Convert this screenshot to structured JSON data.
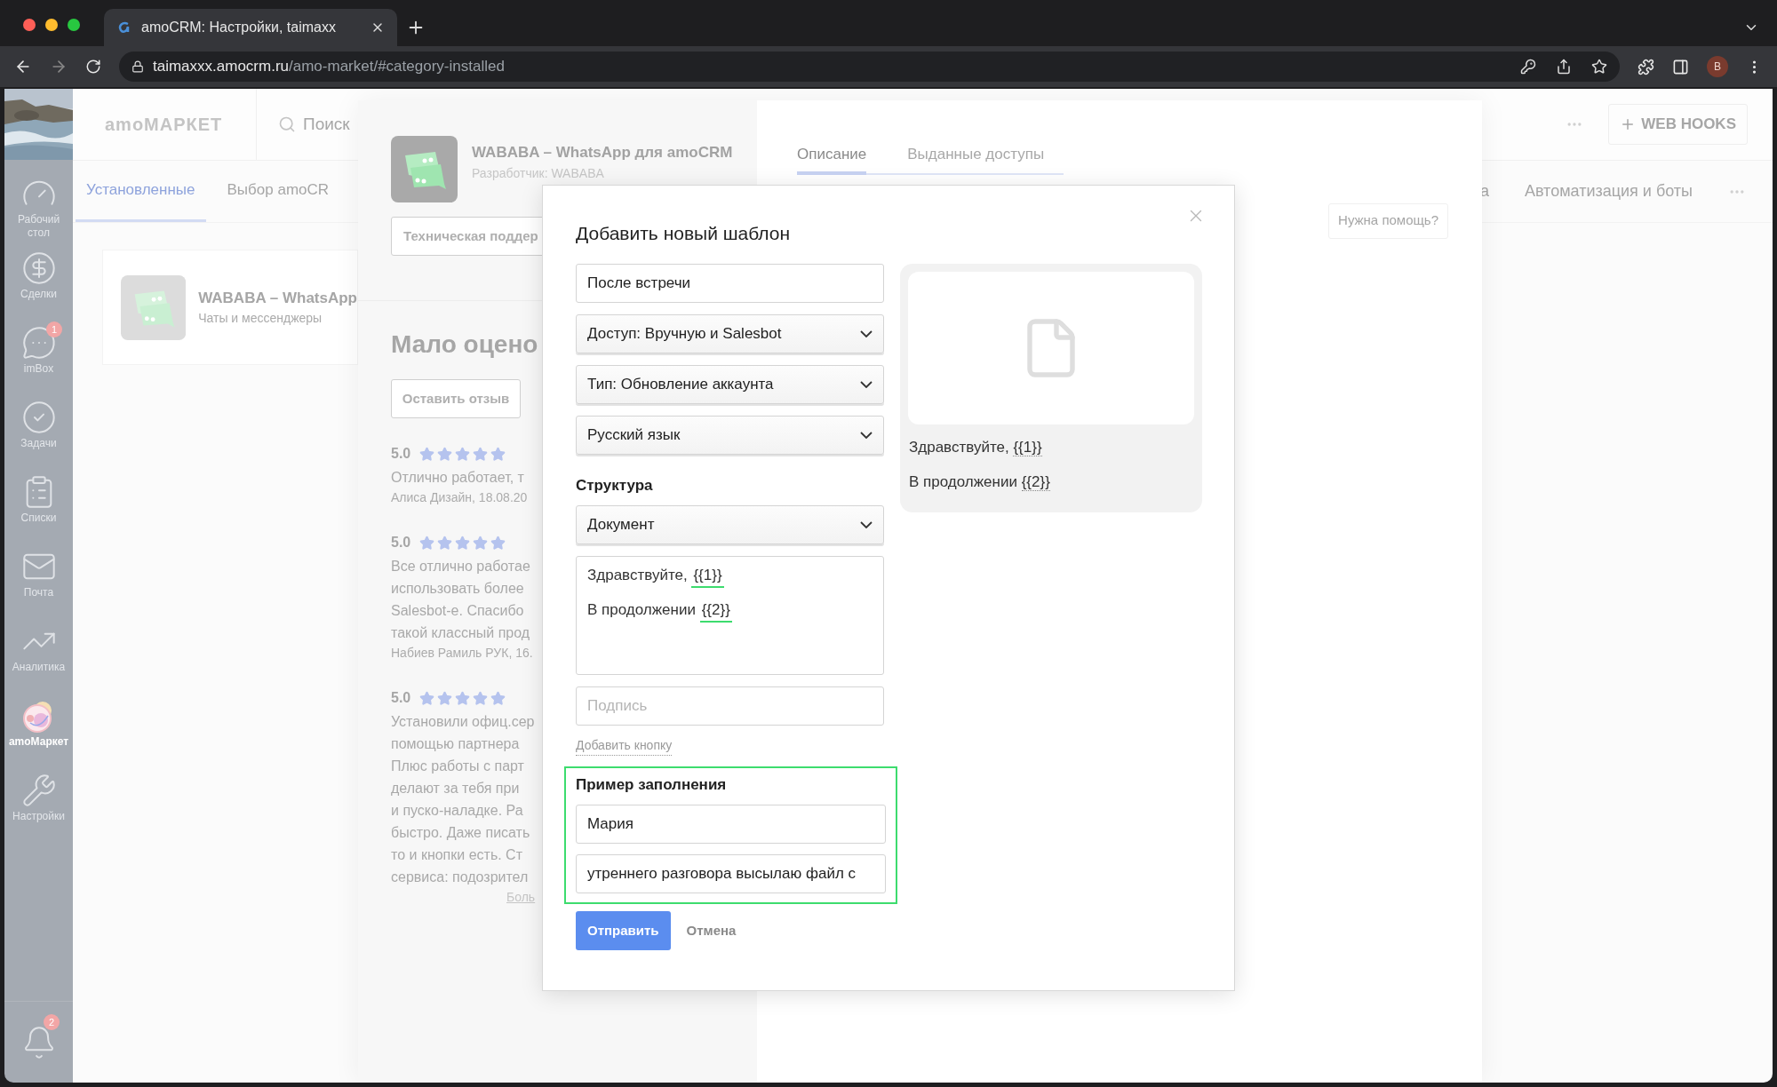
{
  "browser": {
    "tab_title": "amoCRM: Настройки, taimaxx",
    "url_host": "taimaxxx.amocrm.ru",
    "url_path": "/amo-market/#category-installed",
    "profile": "B"
  },
  "sidebar": {
    "items": [
      {
        "label": "Рабочий стол",
        "selected": false
      },
      {
        "label": "Сделки",
        "selected": false
      },
      {
        "label": "imBox",
        "selected": false,
        "badge": "1"
      },
      {
        "label": "Задачи",
        "selected": false
      },
      {
        "label": "Списки",
        "selected": false
      },
      {
        "label": "Почта",
        "selected": false
      },
      {
        "label": "Аналитика",
        "selected": false
      },
      {
        "label": "amoМаркет",
        "selected": true
      },
      {
        "label": "Настройки",
        "selected": false
      }
    ],
    "notifications_badge": "2"
  },
  "header": {
    "logo": "amoМАРКЕТ",
    "search_placeholder": "Поиск",
    "web_hooks_button": "WEB HOOKS"
  },
  "category_tabs": {
    "left": [
      {
        "label": "Установленные",
        "selected": true
      },
      {
        "label": "Выбор amoCR",
        "selected": false
      }
    ],
    "right": [
      {
        "label": "а",
        "selected": false
      },
      {
        "label": "Автоматизация и боты",
        "selected": false
      }
    ]
  },
  "installed_app": {
    "name": "WABABA – WhatsApp",
    "category": "Чаты и мессенджеры"
  },
  "app_panel": {
    "name": "WABABA – WhatsApp для amoCRM",
    "developer": "Разработчик: WABABA",
    "support_button": "Техническая поддер",
    "rating_heading": "Мало оцено",
    "review_button": "Оставить отзыв",
    "reviews": [
      {
        "score": "5.0",
        "stars": 5,
        "lines": [
          "Отлично работает, т"
        ],
        "author": "Алиса Дизайн, 18.08.20"
      },
      {
        "score": "5.0",
        "stars": 5,
        "lines": [
          "Все отлично работае",
          "использовать более",
          "Salesbot-е. Спасибо",
          "такой классный прод"
        ],
        "author": "Набиев Рамиль РУК, 16."
      },
      {
        "score": "5.0",
        "stars": 5,
        "lines": [
          "Установили офиц.сер",
          "помощью партнера",
          "Плюс работы с парт",
          "делают за тебя при",
          "и пуско-наладке. Ра",
          "быстро. Даже писать",
          "то и кнопки есть. Ст",
          "сервиса: подозрител"
        ]
      }
    ],
    "more_link": "Боль",
    "tabs": [
      {
        "label": "Описание",
        "selected": true
      },
      {
        "label": "Выданные доступы",
        "selected": false
      }
    ],
    "help_button": "Нужна помощь?"
  },
  "modal": {
    "title": "Добавить новый шаблон",
    "name_value": "После встречи",
    "selects": [
      "Доступ: Вручную и Salesbot",
      "Тип: Обновление аккаунта",
      "Русский язык"
    ],
    "structure_label": "Структура",
    "structure_select": "Документ",
    "body_lines": [
      {
        "text": "Здравствуйте,",
        "variable": "{{1}}"
      },
      {
        "text": "В продолжении",
        "variable": "{{2}}"
      }
    ],
    "signature_placeholder": "Подпись",
    "add_button_link": "Добавить кнопку",
    "example": {
      "heading": "Пример заполнения",
      "values": [
        "Мария",
        "утреннего разговора высылаю файл с"
      ]
    },
    "submit": "Отправить",
    "cancel": "Отмена",
    "preview_lines": [
      {
        "text": "Здравствуйте,",
        "variable": "{{1}}"
      },
      {
        "text": "В продолжении",
        "variable": "{{2}}"
      }
    ]
  }
}
